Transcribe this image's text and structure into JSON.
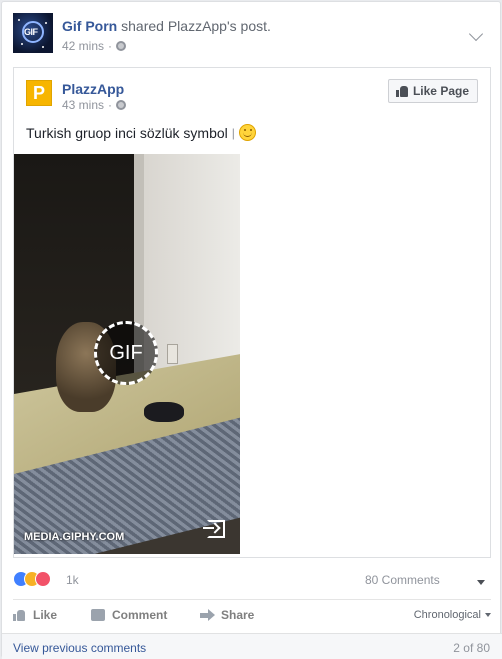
{
  "story": {
    "actor": "Gif Porn",
    "verb": "shared",
    "shared_page": "PlazzApp",
    "object": "'s post.",
    "time": "42 mins",
    "time_dot": "·",
    "privacy_icon": "globe-icon",
    "options_icon": "chevron-down-icon"
  },
  "shared_post": {
    "page_name": "PlazzApp",
    "avatar_letter": "P",
    "time": "43 mins",
    "time_dot": "·",
    "like_page_label": "Like Page",
    "text": "Turkish gruop inci sözlük symbol",
    "text_separator": "|",
    "emoji": "smiling-face-icon",
    "media": {
      "badge": "GIF",
      "credit": "MEDIA.GIPHY.COM",
      "open_icon": "open-external-icon"
    }
  },
  "feedback": {
    "reaction_icons": [
      "like-reaction-icon",
      "haha-reaction-icon",
      "love-reaction-icon"
    ],
    "reaction_count": "1k",
    "comment_count": "80 Comments",
    "menu_icon": "caret-down-icon"
  },
  "actions": {
    "like": "Like",
    "comment": "Comment",
    "share": "Share",
    "ordering": "Chronological"
  },
  "comments": {
    "view_previous": "View previous comments",
    "pager": "2 of 80"
  },
  "colors": {
    "link_blue": "#365899",
    "secondary_text": "#90949c",
    "avatar_yellow": "#f7b500"
  }
}
